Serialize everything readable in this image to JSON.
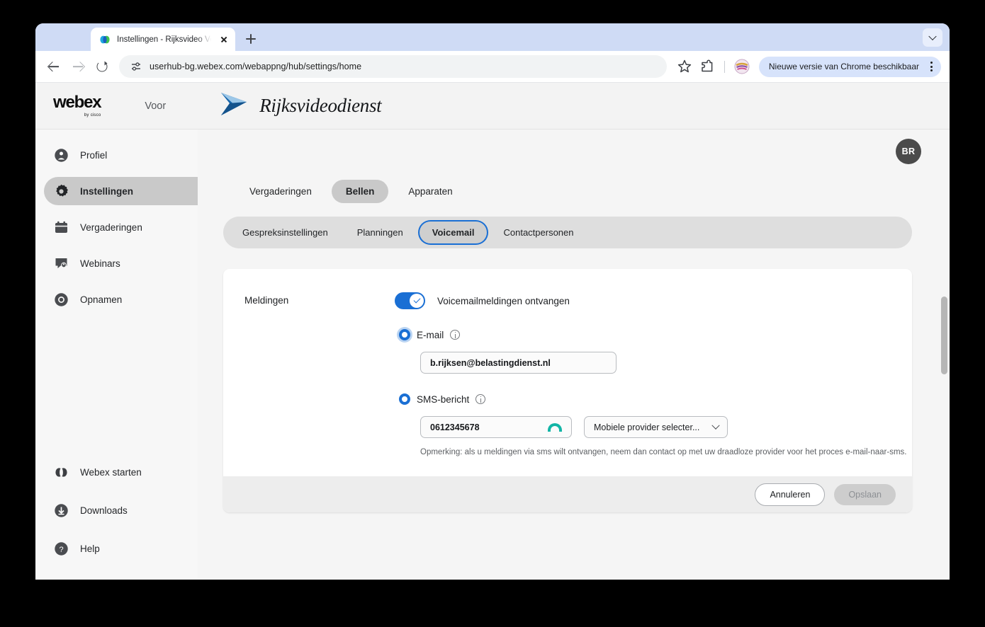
{
  "browser": {
    "tab": {
      "title": "Instellingen - Rijksvideo Verga",
      "favicon": "webex-favicon-icon",
      "close": "close-icon"
    },
    "new_tab": "+",
    "tab_list": "chevron-down-icon",
    "toolbar": {
      "back": "arrow-left-icon",
      "forward": "arrow-right-icon",
      "reload": "reload-icon",
      "site_info": "site-settings-icon",
      "url": "userhub-bg.webex.com/webappng/hub/settings/home",
      "bookmark": "star-icon",
      "extensions": "extensions-icon",
      "profile": "profile-avatar-icon",
      "update_chip": "Nieuwe versie van Chrome beschikbaar",
      "menu": "kebab-menu-icon"
    }
  },
  "header": {
    "product": "webex",
    "byline_prefix": "by",
    "byline": "cisco",
    "voor": "Voor",
    "brand": "Rijksvideodienst",
    "brand_logo": "rijksvideodienst-arrow-logo"
  },
  "sidebar": {
    "items": [
      {
        "label": "Profiel",
        "icon": "person-circle-icon",
        "active": false
      },
      {
        "label": "Instellingen",
        "icon": "gear-icon",
        "active": true
      },
      {
        "label": "Vergaderingen",
        "icon": "calendar-icon",
        "active": false
      },
      {
        "label": "Webinars",
        "icon": "webinar-icon",
        "active": false
      },
      {
        "label": "Opnamen",
        "icon": "record-circle-icon",
        "active": false
      }
    ],
    "bottom_items": [
      {
        "label": "Webex starten",
        "icon": "webex-icon"
      },
      {
        "label": "Downloads",
        "icon": "download-icon"
      },
      {
        "label": "Help",
        "icon": "question-circle-icon"
      }
    ]
  },
  "topbar": {
    "avatar_initials": "BR"
  },
  "primary_tabs": [
    {
      "label": "Vergaderingen",
      "active": false
    },
    {
      "label": "Bellen",
      "active": true
    },
    {
      "label": "Apparaten",
      "active": false
    }
  ],
  "sub_tabs": [
    {
      "label": "Gespreksinstellingen",
      "active": false
    },
    {
      "label": "Planningen",
      "active": false
    },
    {
      "label": "Voicemail",
      "active": true
    },
    {
      "label": "Contactpersonen",
      "active": false
    }
  ],
  "card": {
    "section_label": "Meldingen",
    "toggle": {
      "label": "Voicemailmeldingen ontvangen",
      "on": true
    },
    "email_option": {
      "label": "E-mail",
      "info": "info-icon",
      "selected": true,
      "value": "b.rijksen@belastingdienst.nl"
    },
    "sms_option": {
      "label": "SMS-bericht",
      "info": "info-icon",
      "selected": true,
      "phone_value": "0612345678",
      "autofill_icon": "autofill-arc-icon",
      "provider_value": "Mobiele provider selecter...",
      "provider_chevron": "chevron-down-icon"
    },
    "note": "Opmerking: als u meldingen via sms wilt ontvangen, neem dan contact op met uw draadloze provider voor het proces e-mail-naar-sms.",
    "footer": {
      "cancel": "Annuleren",
      "save": "Opslaan"
    }
  },
  "colors": {
    "accent_blue": "#1a6fd4",
    "autofill_teal": "#13b5a6",
    "active_pill": "#c9c9c9",
    "avatar_bg": "#4b4b4b"
  }
}
